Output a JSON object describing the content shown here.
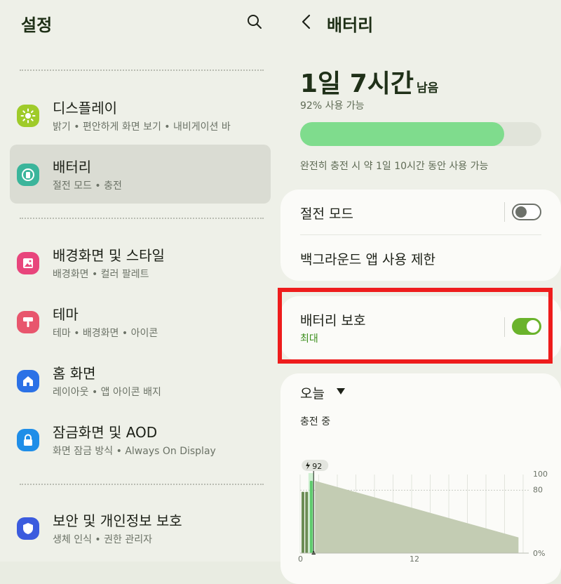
{
  "left": {
    "title": "설정",
    "items": [
      {
        "label": "디스플레이",
        "sub": "밝기 • 편안하게 화면 보기 • 내비게이션 바",
        "icon": "sun-icon",
        "color": "#9fcb2a"
      },
      {
        "label": "배터리",
        "sub": "절전 모드 • 충전",
        "icon": "battery-icon",
        "color": "#3bb59b",
        "selected": true
      },
      {
        "label": "배경화면 및 스타일",
        "sub": "배경화면 • 컬러 팔레트",
        "icon": "wallpaper-icon",
        "color": "#e8457c"
      },
      {
        "label": "테마",
        "sub": "테마 • 배경화면 • 아이콘",
        "icon": "paint-roller-icon",
        "color": "#e8566d"
      },
      {
        "label": "홈 화면",
        "sub": "레이아웃 • 앱 아이콘 배지",
        "icon": "home-icon",
        "color": "#2b71e6"
      },
      {
        "label": "잠금화면 및 AOD",
        "sub": "화면 잠금 방식 • Always On Display",
        "icon": "lock-icon",
        "color": "#1f8ee8"
      },
      {
        "label": "보안 및 개인정보 보호",
        "sub": "생체 인식 • 권한 관리자",
        "icon": "shield-icon",
        "color": "#3b5bde"
      }
    ]
  },
  "right": {
    "title": "배터리",
    "remaining_time": "1일 7시간",
    "remaining_suffix": "남음",
    "available": "92% 사용 가능",
    "battery_level": 0.92,
    "full_charge_note": "완전히 충전 시 약 1일 10시간 동안 사용 가능",
    "power_saving_label": "절전 모드",
    "power_saving_on": false,
    "background_limit_label": "백그라운드 앱 사용 제한",
    "protection_label": "배터리 보호",
    "protection_value": "최대",
    "protection_on": true,
    "period_label": "오늘",
    "charging_label": "충전 중"
  },
  "colors": {
    "bar_fill": "#7fdc8d",
    "toggle_on": "#6ab32c",
    "highlight": "#ee1c1c",
    "chart_area": "#c3ccb3",
    "chart_bar": "#4fc45e"
  },
  "chart_data": {
    "type": "area",
    "badge": "92",
    "x_tick_labels": [
      "0",
      "12"
    ],
    "y_tick_labels": [
      "100",
      "80",
      "0%"
    ],
    "ylim": [
      0,
      100
    ],
    "xlim": [
      0,
      24
    ],
    "grid": true,
    "reference_line": 80,
    "charge_bars": [
      {
        "x": 0.3,
        "value": 78,
        "color": "#6a8c54"
      },
      {
        "x": 0.7,
        "value": 78,
        "color": "#6a8c54"
      },
      {
        "x": 1.2,
        "value": 92,
        "color": "#4fc45e"
      }
    ],
    "projection": [
      {
        "x": 1.6,
        "value": 92
      },
      {
        "x": 23.5,
        "value": 20
      }
    ]
  }
}
